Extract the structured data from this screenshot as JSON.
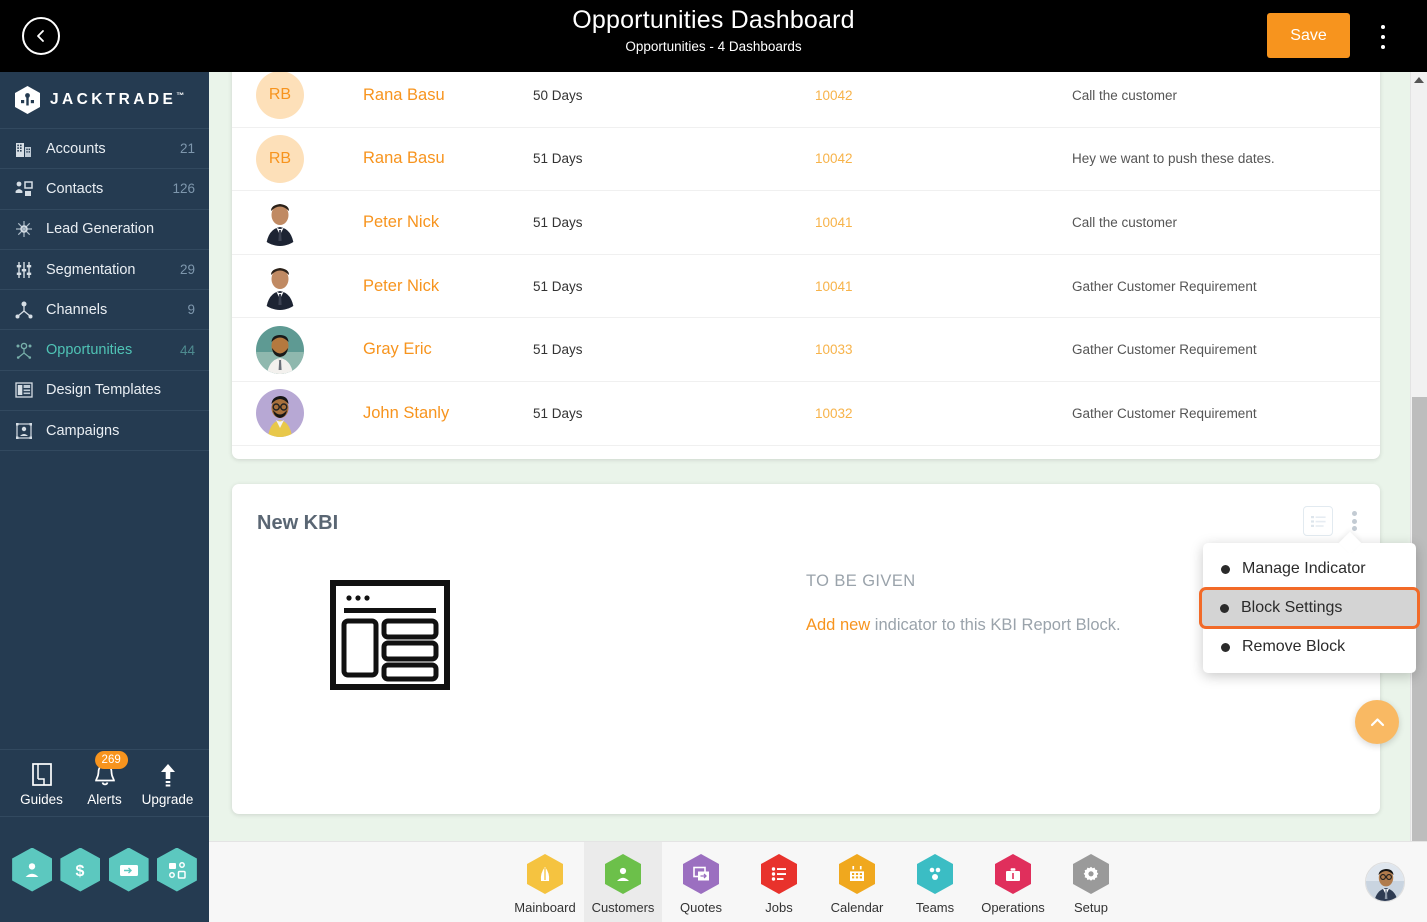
{
  "header": {
    "title": "Opportunities Dashboard",
    "subtitle": "Opportunities - 4 Dashboards",
    "save_label": "Save",
    "back_icon": "chevron-left-icon",
    "menu_icon": "kebab-menu-icon"
  },
  "brand": {
    "name": "JACKTRADE",
    "tm": "™"
  },
  "sidebar": {
    "items": [
      {
        "label": "Accounts",
        "count": "21",
        "icon": "building-icon",
        "active": false
      },
      {
        "label": "Contacts",
        "count": "126",
        "icon": "contacts-icon",
        "active": false
      },
      {
        "label": "Lead Generation",
        "count": "",
        "icon": "lead-generation-icon",
        "active": false
      },
      {
        "label": "Segmentation",
        "count": "29",
        "icon": "segmentation-icon",
        "active": false
      },
      {
        "label": "Channels",
        "count": "9",
        "icon": "channels-icon",
        "active": false
      },
      {
        "label": "Opportunities",
        "count": "44",
        "icon": "opportunities-icon",
        "active": true
      },
      {
        "label": "Design Templates",
        "count": "",
        "icon": "design-templates-icon",
        "active": false
      },
      {
        "label": "Campaigns",
        "count": "",
        "icon": "campaigns-icon",
        "active": false
      }
    ],
    "tools": [
      {
        "label": "Guides",
        "icon": "book-icon",
        "badge": ""
      },
      {
        "label": "Alerts",
        "icon": "bell-icon",
        "badge": "269"
      },
      {
        "label": "Upgrade",
        "icon": "up-arrow-icon",
        "badge": ""
      }
    ],
    "hex_buttons": [
      {
        "icon": "person-hex-icon",
        "color": "#5cc8bf"
      },
      {
        "icon": "dollar-hex-icon",
        "color": "#5cc8bf"
      },
      {
        "icon": "payment-hex-icon",
        "color": "#5cc8bf"
      },
      {
        "icon": "workflow-hex-icon",
        "color": "#5cc8bf"
      }
    ]
  },
  "table": {
    "rows": [
      {
        "avatar_type": "initials",
        "initials": "RB",
        "name": "Rana Basu",
        "days": "50 Days",
        "id": "10042",
        "note": "Call the customer"
      },
      {
        "avatar_type": "initials",
        "initials": "RB",
        "name": "Rana Basu",
        "days": "51 Days",
        "id": "10042",
        "note": "Hey we want to push these dates."
      },
      {
        "avatar_type": "photo",
        "photo": "man-suit-1",
        "name": "Peter Nick",
        "days": "51 Days",
        "id": "10041",
        "note": "Call the customer"
      },
      {
        "avatar_type": "photo",
        "photo": "man-suit-1",
        "name": "Peter Nick",
        "days": "51 Days",
        "id": "10041",
        "note": "Gather Customer Requirement"
      },
      {
        "avatar_type": "photo",
        "photo": "man-beard-teal",
        "name": "Gray Eric",
        "days": "51 Days",
        "id": "10033",
        "note": "Gather Customer Requirement"
      },
      {
        "avatar_type": "photo",
        "photo": "man-glasses-purple",
        "name": "John Stanly",
        "days": "51 Days",
        "id": "10032",
        "note": "Gather Customer Requirement"
      }
    ]
  },
  "kbi": {
    "title": "New KBI",
    "placeholder_icon": "report-layout-icon",
    "to_be_given": "TO BE GIVEN",
    "add_link": "Add new",
    "add_rest": " indicator to this KBI Report Block.",
    "list_icon": "list-view-icon",
    "menu_icon": "kebab-menu-icon"
  },
  "dropdown": {
    "items": [
      {
        "label": "Manage Indicator",
        "selected": false
      },
      {
        "label": "Block Settings",
        "selected": true
      },
      {
        "label": "Remove Block",
        "selected": false
      }
    ]
  },
  "fab": {
    "icon": "chevron-up-icon"
  },
  "bottom_nav": {
    "items": [
      {
        "label": "Mainboard",
        "icon": "mainboard-icon",
        "color": "#f5c340",
        "active": false
      },
      {
        "label": "Customers",
        "icon": "customers-icon",
        "color": "#6cc04a",
        "active": true
      },
      {
        "label": "Quotes",
        "icon": "quotes-icon",
        "color": "#9b6fc0",
        "active": false
      },
      {
        "label": "Jobs",
        "icon": "jobs-icon",
        "color": "#e8322c",
        "active": false
      },
      {
        "label": "Calendar",
        "icon": "calendar-icon",
        "color": "#f0a81e",
        "active": false
      },
      {
        "label": "Teams",
        "icon": "teams-icon",
        "color": "#3bbdc4",
        "active": false
      },
      {
        "label": "Operations",
        "icon": "operations-icon",
        "color": "#e02f5c",
        "active": false
      },
      {
        "label": "Setup",
        "icon": "setup-gear-icon",
        "color": "#9a9a9a",
        "active": false
      }
    ],
    "user_avatar": "man-suit-2"
  },
  "colors": {
    "accent_orange": "#f7941e",
    "sidebar_bg": "#253b51",
    "page_bg": "#eaf4ea",
    "active_teal": "#4fc3b5",
    "highlight_border": "#f26a28"
  }
}
